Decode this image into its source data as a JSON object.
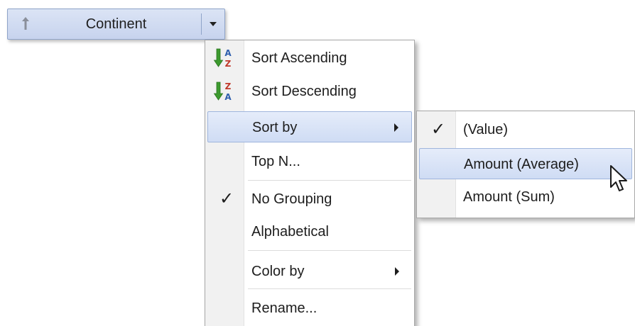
{
  "field_header": {
    "title": "Continent",
    "sort_icon": "sort-up-arrow-icon",
    "dropdown_icon": "dropdown-triangle-icon"
  },
  "context_menu": {
    "sort_ascending": "Sort Ascending",
    "sort_descending": "Sort Descending",
    "sort_by": "Sort by",
    "top_n": "Top N...",
    "no_grouping": "No Grouping",
    "alphabetical": "Alphabetical",
    "color_by": "Color by",
    "rename": "Rename...",
    "checked_item": "No Grouping",
    "highlighted_item": "Sort by"
  },
  "sort_by_submenu": {
    "value": "(Value)",
    "amount_average": "Amount (Average)",
    "amount_sum": "Amount (Sum)",
    "checked_item": "(Value)",
    "highlighted_item": "Amount (Average)"
  },
  "colors": {
    "highlight": "#cfdcf4",
    "highlight_border": "#9fb5dd",
    "header_bg": "#c7d3ee",
    "arrow_green": "#3c9a2e",
    "letter_blue": "#2f5fae",
    "letter_red": "#c0392b"
  }
}
